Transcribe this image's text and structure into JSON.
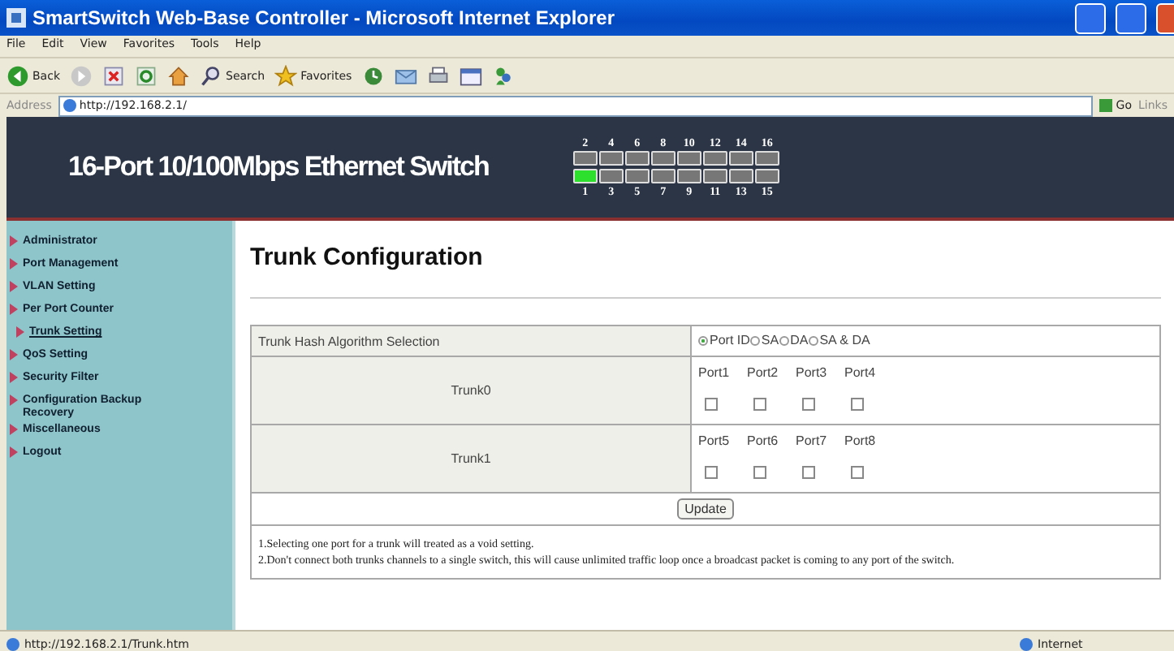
{
  "window": {
    "title": "SmartSwitch Web-Base Controller - Microsoft Internet Explorer"
  },
  "menu": [
    "File",
    "Edit",
    "View",
    "Favorites",
    "Tools",
    "Help"
  ],
  "toolbar": [
    {
      "kind": "back",
      "label": "Back"
    },
    {
      "kind": "forward"
    },
    {
      "kind": "stop"
    },
    {
      "kind": "refresh"
    },
    {
      "kind": "home"
    },
    {
      "kind": "search",
      "label": "Search"
    },
    {
      "kind": "favorites",
      "label": "Favorites"
    },
    {
      "kind": "history"
    },
    {
      "kind": "mail"
    },
    {
      "kind": "print"
    },
    {
      "kind": "edit"
    },
    {
      "kind": "messenger"
    }
  ],
  "address_bar": {
    "label": "Address",
    "value": "http://192.168.2.1/",
    "go": "Go",
    "links": "Links"
  },
  "banner": {
    "title": "16-Port 10/100Mbps Ethernet Switch",
    "top_ports": [
      {
        "label": "2",
        "active": false
      },
      {
        "label": "4",
        "active": false
      },
      {
        "label": "6",
        "active": false
      },
      {
        "label": "8",
        "active": false
      },
      {
        "label": "10",
        "active": false
      },
      {
        "label": "12",
        "active": false
      },
      {
        "label": "14",
        "active": false
      },
      {
        "label": "16",
        "active": false
      }
    ],
    "bottom_ports": [
      {
        "label": "1",
        "active": true
      },
      {
        "label": "3",
        "active": false
      },
      {
        "label": "5",
        "active": false
      },
      {
        "label": "7",
        "active": false
      },
      {
        "label": "9",
        "active": false
      },
      {
        "label": "11",
        "active": false
      },
      {
        "label": "13",
        "active": false
      },
      {
        "label": "15",
        "active": false
      }
    ]
  },
  "sidebar": {
    "items": [
      {
        "label": "Administrator",
        "selected": false
      },
      {
        "label": "Port Management",
        "selected": false
      },
      {
        "label": "VLAN Setting",
        "selected": false
      },
      {
        "label": "Per Port Counter",
        "selected": false
      },
      {
        "label": "Trunk Setting",
        "selected": true
      },
      {
        "label": "QoS Setting",
        "selected": false
      },
      {
        "label": "Security Filter",
        "selected": false
      },
      {
        "label": "Configuration Backup Recovery",
        "selected": false
      },
      {
        "label": "Miscellaneous",
        "selected": false
      },
      {
        "label": "Logout",
        "selected": false
      }
    ]
  },
  "page": {
    "title": "Trunk Configuration",
    "hash": {
      "label": "Trunk Hash Algorithm Selection",
      "options": [
        {
          "label": "Port ID",
          "selected": true
        },
        {
          "label": "SA",
          "selected": false
        },
        {
          "label": "DA",
          "selected": false
        },
        {
          "label": "SA & DA",
          "selected": false
        }
      ]
    },
    "trunks": [
      {
        "name": "Trunk0",
        "ports": [
          {
            "label": "Port1",
            "checked": false
          },
          {
            "label": "Port2",
            "checked": false
          },
          {
            "label": "Port3",
            "checked": false
          },
          {
            "label": "Port4",
            "checked": false
          }
        ]
      },
      {
        "name": "Trunk1",
        "ports": [
          {
            "label": "Port5",
            "checked": false
          },
          {
            "label": "Port6",
            "checked": false
          },
          {
            "label": "Port7",
            "checked": false
          },
          {
            "label": "Port8",
            "checked": false
          }
        ]
      }
    ],
    "update_button": "Update",
    "notes": [
      "1.Selecting one port for a trunk will treated as a void setting.",
      "2.Don't connect both trunks channels to a single switch, this will cause unlimited traffic loop once a broadcast packet is coming to any port of the switch."
    ]
  },
  "status_bar": {
    "url": "http://192.168.2.1/Trunk.htm",
    "zone": "Internet"
  }
}
